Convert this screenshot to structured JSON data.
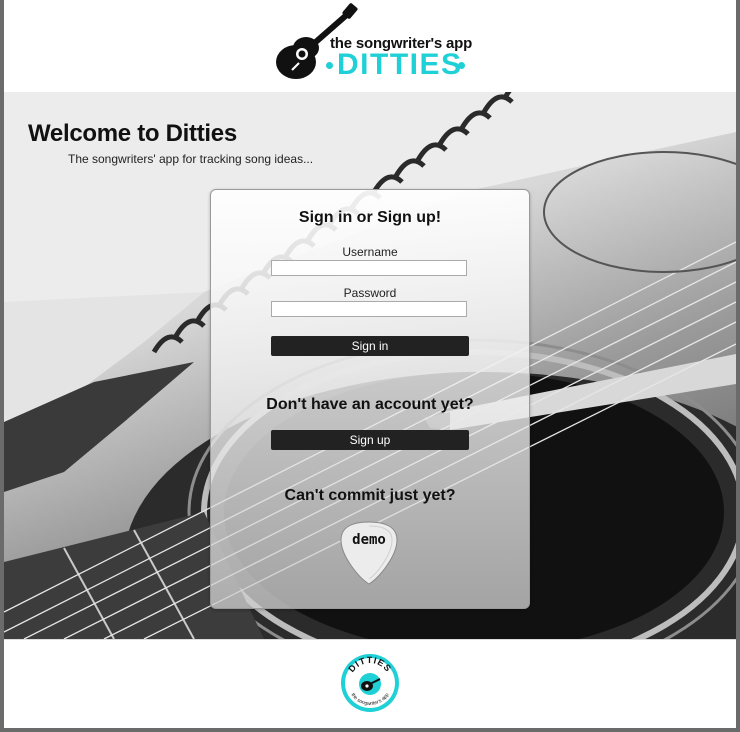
{
  "header": {
    "logo": {
      "tagline": "the songwriter's app",
      "name": "DITTIES",
      "icon": "guitar-icon",
      "accent_color": "#1fd0d6"
    }
  },
  "welcome": {
    "title": "Welcome to Ditties",
    "subtitle": "The songwriters' app for tracking song ideas..."
  },
  "auth_card": {
    "signin_heading": "Sign in or Sign up!",
    "username_label": "Username",
    "username_value": "",
    "password_label": "Password",
    "password_value": "",
    "signin_button": "Sign in",
    "no_account_heading": "Don't have an account yet?",
    "signup_button": "Sign up",
    "commit_heading": "Can't commit just yet?",
    "demo_button": "demo",
    "demo_icon": "guitar-pick-icon"
  },
  "footer": {
    "badge_text": "DITTIES",
    "badge_subtext": "the songwriter's app",
    "badge_color": "#1fd0d6"
  }
}
